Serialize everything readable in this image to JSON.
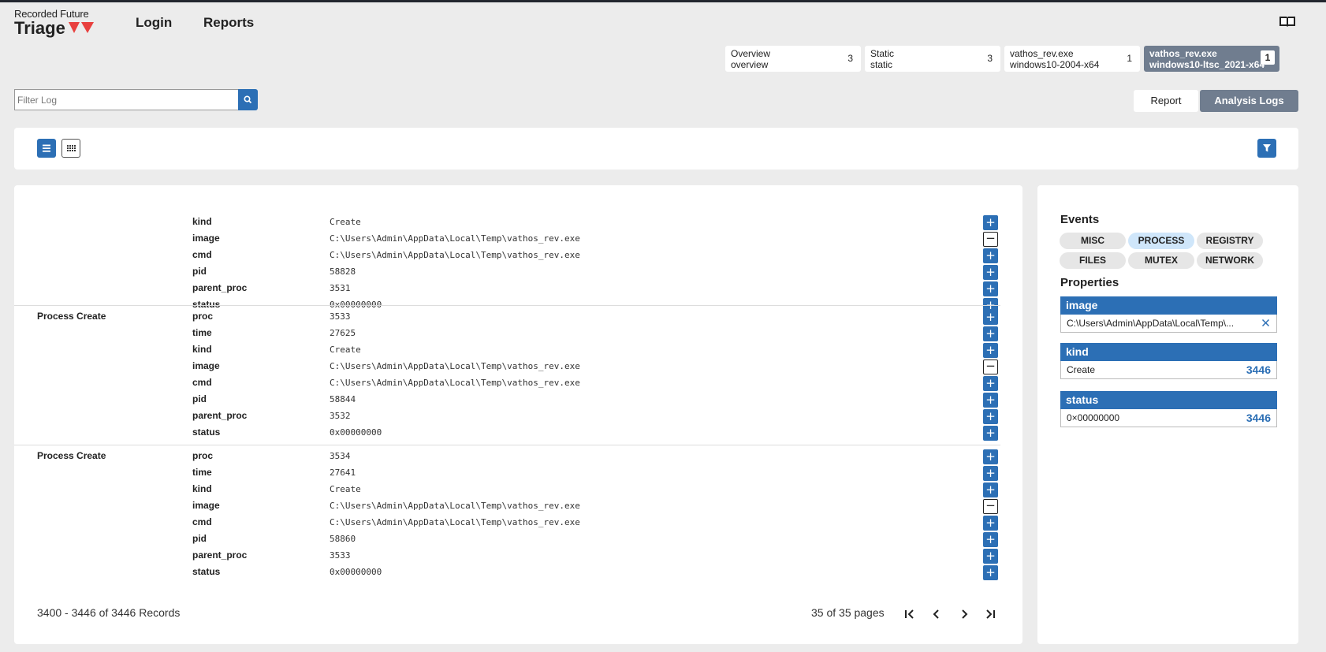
{
  "header": {
    "brand": "Recorded Future",
    "product": "Triage",
    "nav": [
      "Login",
      "Reports"
    ]
  },
  "tabs": [
    {
      "line1": "Overview",
      "line2": "overview",
      "count": "3"
    },
    {
      "line1": "Static",
      "line2": "static",
      "count": "3"
    },
    {
      "line1": "vathos_rev.exe",
      "line2": "windows10-2004-x64",
      "count": "1"
    },
    {
      "line1": "vathos_rev.exe",
      "line2": "windows10-ltsc_2021-x64",
      "count": "1"
    }
  ],
  "filter": {
    "placeholder": "Filter Log"
  },
  "view_buttons": {
    "report": "Report",
    "analysis_logs": "Analysis Logs"
  },
  "records": [
    {
      "title": "",
      "rows": [
        {
          "key": "kind",
          "value": "Create",
          "btn": "+"
        },
        {
          "key": "image",
          "value": "C:\\Users\\Admin\\AppData\\Local\\Temp\\vathos_rev.exe",
          "btn": "−"
        },
        {
          "key": "cmd",
          "value": "C:\\Users\\Admin\\AppData\\Local\\Temp\\vathos_rev.exe",
          "btn": "+"
        },
        {
          "key": "pid",
          "value": "58828",
          "btn": "+"
        },
        {
          "key": "parent_proc",
          "value": "3531",
          "btn": "+"
        },
        {
          "key": "status",
          "value": "0x00000000",
          "btn": "+"
        }
      ]
    },
    {
      "title": "Process Create",
      "rows": [
        {
          "key": "proc",
          "value": "3533",
          "btn": "+"
        },
        {
          "key": "time",
          "value": "27625",
          "btn": "+"
        },
        {
          "key": "kind",
          "value": "Create",
          "btn": "+"
        },
        {
          "key": "image",
          "value": "C:\\Users\\Admin\\AppData\\Local\\Temp\\vathos_rev.exe",
          "btn": "−"
        },
        {
          "key": "cmd",
          "value": "C:\\Users\\Admin\\AppData\\Local\\Temp\\vathos_rev.exe",
          "btn": "+"
        },
        {
          "key": "pid",
          "value": "58844",
          "btn": "+"
        },
        {
          "key": "parent_proc",
          "value": "3532",
          "btn": "+"
        },
        {
          "key": "status",
          "value": "0x00000000",
          "btn": "+"
        }
      ]
    },
    {
      "title": "Process Create",
      "rows": [
        {
          "key": "proc",
          "value": "3534",
          "btn": "+"
        },
        {
          "key": "time",
          "value": "27641",
          "btn": "+"
        },
        {
          "key": "kind",
          "value": "Create",
          "btn": "+"
        },
        {
          "key": "image",
          "value": "C:\\Users\\Admin\\AppData\\Local\\Temp\\vathos_rev.exe",
          "btn": "−"
        },
        {
          "key": "cmd",
          "value": "C:\\Users\\Admin\\AppData\\Local\\Temp\\vathos_rev.exe",
          "btn": "+"
        },
        {
          "key": "pid",
          "value": "58860",
          "btn": "+"
        },
        {
          "key": "parent_proc",
          "value": "3533",
          "btn": "+"
        },
        {
          "key": "status",
          "value": "0x00000000",
          "btn": "+"
        }
      ]
    }
  ],
  "pagination": {
    "records_text": "3400 - 3446 of 3446 Records",
    "pages_text": "35 of 35 pages"
  },
  "sidebar": {
    "events_heading": "Events",
    "chips": [
      {
        "label": "MISC",
        "active": false
      },
      {
        "label": "PROCESS",
        "active": true
      },
      {
        "label": "REGISTRY",
        "active": false
      },
      {
        "label": "FILES",
        "active": false
      },
      {
        "label": "MUTEX",
        "active": false
      },
      {
        "label": "NETWORK",
        "active": false
      }
    ],
    "properties_heading": "Properties",
    "properties": [
      {
        "name": "image",
        "value": "C:\\Users\\Admin\\AppData\\Local\\Temp\\...",
        "count": "",
        "removable": true
      },
      {
        "name": "kind",
        "value": "Create",
        "count": "3446",
        "removable": false
      },
      {
        "name": "status",
        "value": "0×00000000",
        "count": "3446",
        "removable": false
      }
    ]
  },
  "colors": {
    "accent": "#2c6fb5",
    "active_tab": "#707d8f",
    "background": "#ececec"
  }
}
